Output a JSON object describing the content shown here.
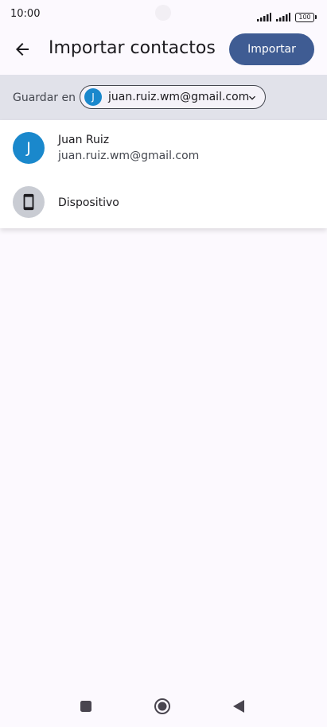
{
  "status_bar": {
    "time": "10:00",
    "battery": "100"
  },
  "app_bar": {
    "title": "Importar contactos",
    "import_label": "Importar",
    "accent_color": "#3f5c93"
  },
  "save_bar": {
    "label": "Guardar en",
    "selected_account": {
      "initial": "J",
      "email": "juan.ruiz.wm@gmail.com"
    }
  },
  "dropdown": {
    "items": [
      {
        "initial": "J",
        "name": "Juan Ruiz",
        "email": "juan.ruiz.wm@gmail.com",
        "avatar_color": "#1a88cc"
      },
      {
        "icon": "smartphone-icon",
        "name": "Dispositivo"
      }
    ]
  },
  "nav_bar": {
    "icons": [
      "recents-square-icon",
      "home-circle-icon",
      "back-triangle-icon"
    ]
  }
}
